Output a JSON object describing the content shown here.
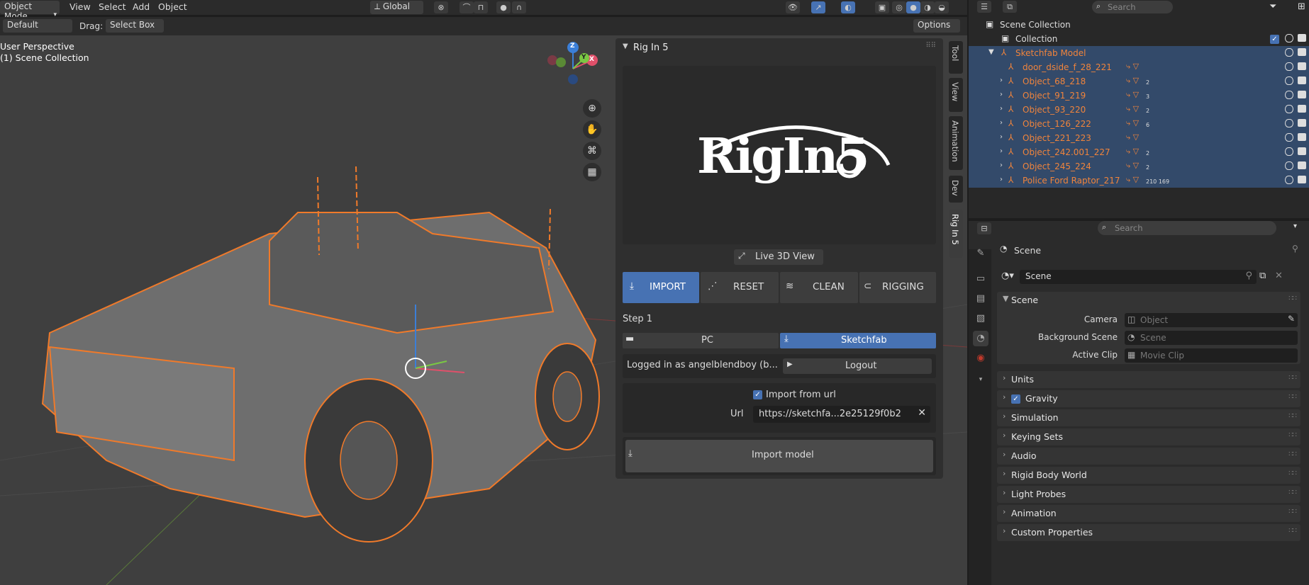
{
  "header": {
    "mode": "Object Mode",
    "menus": [
      "View",
      "Select",
      "Add",
      "Object"
    ],
    "orientation": "Global"
  },
  "toolbar": {
    "orientation_label": "Default",
    "drag_label": "Drag:",
    "drag_value": "Select Box",
    "options": "Options"
  },
  "viewport": {
    "perspective": "User Perspective",
    "collection": "(1) Scene Collection",
    "gizmo": {
      "z": "Z",
      "y": "Y",
      "x": "X"
    }
  },
  "npanel": {
    "title": "Rig In 5",
    "logo": "RigIn5",
    "live_view": "Live 3D View",
    "actions": [
      {
        "label": "IMPORT"
      },
      {
        "label": "RESET"
      },
      {
        "label": "CLEAN"
      },
      {
        "label": "RIGGING"
      }
    ],
    "step": "Step 1",
    "source": {
      "pc": "PC",
      "sketchfab": "Sketchfab"
    },
    "logged_in": "Logged in as angelblendboy (b...",
    "logout": "Logout",
    "import_from_url": "Import from url",
    "url_label": "Url",
    "url_value": "https://sketchfa...2e25129f0b2",
    "import_model": "Import model",
    "tabs": [
      "Tool",
      "View",
      "Animation",
      "Dev",
      "Rig In 5"
    ]
  },
  "outliner": {
    "search_placeholder": "Search",
    "scene_collection": "Scene Collection",
    "collection": "Collection",
    "root": "Sketchfab Model",
    "items": [
      {
        "name": "door_dside_f_28_221",
        "badge": ""
      },
      {
        "name": "Object_68_218",
        "badge": "2"
      },
      {
        "name": "Object_91_219",
        "badge": "3"
      },
      {
        "name": "Object_93_220",
        "badge": "2"
      },
      {
        "name": "Object_126_222",
        "badge": "6"
      },
      {
        "name": "Object_221_223",
        "badge": ""
      },
      {
        "name": "Object_242.001_227",
        "badge": "2"
      },
      {
        "name": "Object_245_224",
        "badge": "2"
      },
      {
        "name": "Police Ford Raptor_217",
        "badge": "210 169"
      }
    ]
  },
  "properties": {
    "search_placeholder": "Search",
    "context": "Scene",
    "datablock": "Scene",
    "panel": "Scene",
    "camera_label": "Camera",
    "camera_placeholder": "Object",
    "bg_label": "Background Scene",
    "bg_placeholder": "Scene",
    "clip_label": "Active Clip",
    "clip_placeholder": "Movie Clip",
    "sections": [
      "Units",
      "Gravity",
      "Simulation",
      "Keying Sets",
      "Audio",
      "Rigid Body World",
      "Light Probes",
      "Animation",
      "Custom Properties"
    ]
  },
  "colors": {
    "accent": "#4772b3",
    "selection_orange": "#f0843c",
    "panel_bg": "#2f2f2f"
  }
}
